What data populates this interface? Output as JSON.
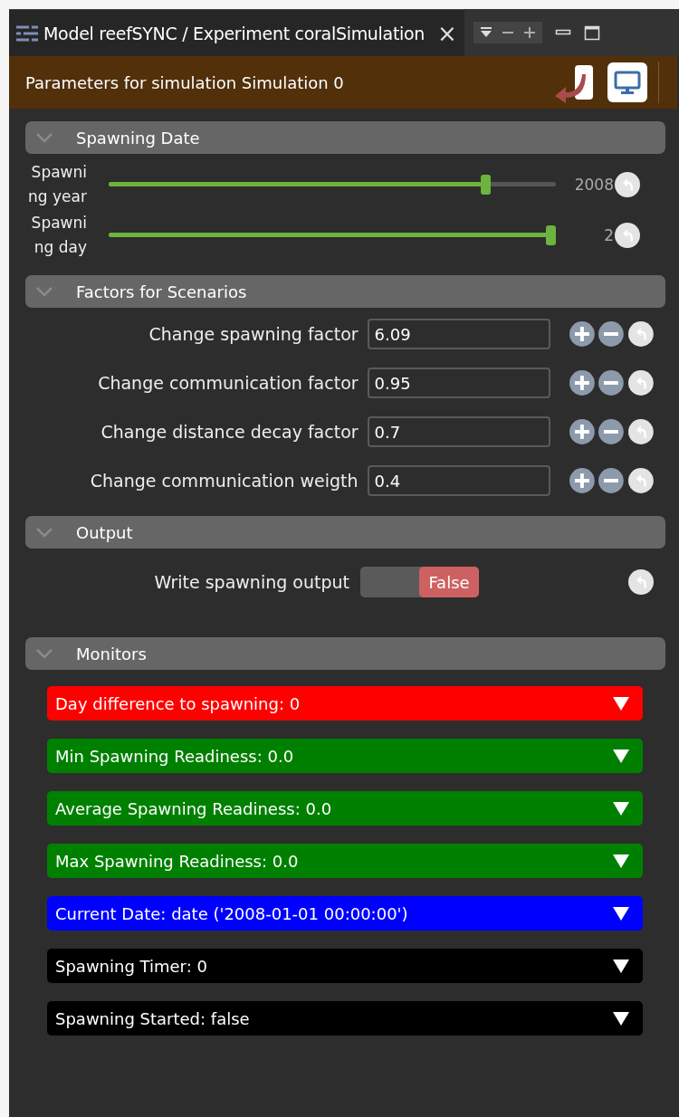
{
  "window": {
    "title": "Model reefSYNC / Experiment coralSimulation",
    "close": "×"
  },
  "header": {
    "title": "Parameters for simulation Simulation 0"
  },
  "sections": [
    {
      "title": "Spawning Date",
      "expanded": true,
      "kind": "sliders",
      "items": [
        {
          "label": "Spawning year",
          "level": 0.85,
          "reading": "2008"
        },
        {
          "label": "Spawning day",
          "level": 1.0,
          "reading": "2"
        }
      ]
    },
    {
      "title": "Factors for Scenarios",
      "expanded": true,
      "kind": "fields",
      "items": [
        {
          "label": "Change spawning factor",
          "value": "6.09"
        },
        {
          "label": "Change communication factor",
          "value": "0.95"
        },
        {
          "label": "Change distance decay factor",
          "value": "0.7"
        },
        {
          "label": "Change communication weigth",
          "value": "0.4"
        }
      ]
    },
    {
      "title": "Output",
      "expanded": true,
      "kind": "switches",
      "items": [
        {
          "label": "Write spawning output",
          "on": false,
          "value": "False"
        }
      ]
    },
    {
      "title": "Monitors",
      "expanded": true,
      "kind": "monitors",
      "items": [
        {
          "text": "Day difference to spawning: 0",
          "color": "#ff0000"
        },
        {
          "text": "Min Spawning Readiness: 0.0",
          "color": "#008000"
        },
        {
          "text": "Average Spawning Readiness: 0.0",
          "color": "#008000"
        },
        {
          "text": "Max Spawning Readiness: 0.0",
          "color": "#008000"
        },
        {
          "text": "Current Date: date ('2008-01-01 00:00:00')",
          "color": "#0000ff"
        },
        {
          "text": "Spawning Timer: 0",
          "color": "#000000"
        },
        {
          "text": "Spawning Started: false",
          "color": "#000000"
        }
      ]
    }
  ]
}
